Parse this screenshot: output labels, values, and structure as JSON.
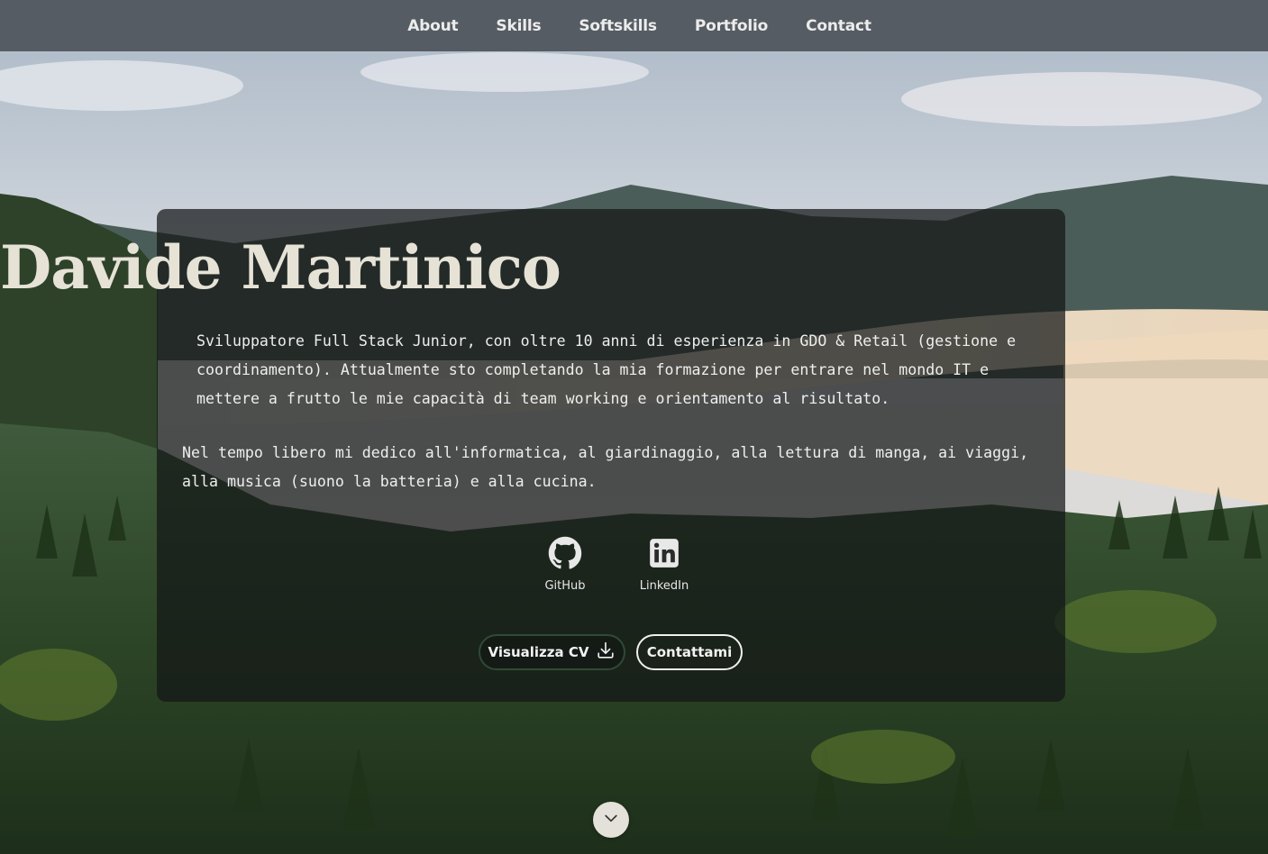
{
  "nav": {
    "items": [
      {
        "label": "About"
      },
      {
        "label": "Skills"
      },
      {
        "label": "Softskills"
      },
      {
        "label": "Portfolio"
      },
      {
        "label": "Contact"
      }
    ]
  },
  "hero": {
    "name": "Davide Martinico",
    "bio_1": "Sviluppatore Full Stack Junior, con oltre 10 anni di esperienza in GDO & Retail (gestione e coordinamento). Attualmente sto completando la mia formazione per entrare nel mondo IT e mettere a frutto le mie capacità di team working e orientamento al risultato.",
    "bio_2": "Nel tempo libero mi dedico all'informatica, al giardinaggio, alla lettura di manga, ai viaggi, alla musica (suono la batteria) e alla cucina.",
    "socials": [
      {
        "label": "GitHub",
        "icon": "github-icon"
      },
      {
        "label": "LinkedIn",
        "icon": "linkedin-icon"
      }
    ],
    "cv_button": "Visualizza CV",
    "contact_button": "Contattami"
  },
  "scroll": {
    "icon": "chevron-down-icon"
  },
  "colors": {
    "navbar": "#4e545a",
    "card": "#141616",
    "title": "#e6e2d6",
    "cv_border": "#2f4a36"
  }
}
